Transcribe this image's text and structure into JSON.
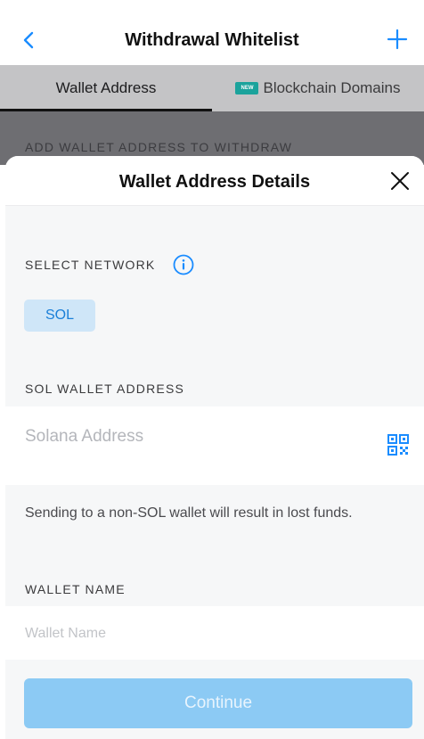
{
  "nav": {
    "title": "Withdrawal Whitelist"
  },
  "tabs": [
    {
      "label": "Wallet Address",
      "active": true
    },
    {
      "label": "Blockchain Domains",
      "badge": "NEW",
      "active": false
    }
  ],
  "background_caption": "ADD WALLET ADDRESS TO WITHDRAW",
  "sheet": {
    "title": "Wallet Address Details",
    "network": {
      "label": "SELECT NETWORK",
      "selected": "SOL"
    },
    "address": {
      "label": "SOL WALLET ADDRESS",
      "placeholder": "Solana Address"
    },
    "warning": "Sending to a non-SOL wallet will result in lost funds.",
    "wallet_name": {
      "label": "WALLET NAME",
      "placeholder": "Wallet Name"
    },
    "continue_label": "Continue"
  },
  "colors": {
    "accent": "#1a8cff",
    "chip_bg": "#cfe6f8",
    "button_disabled": "#8ccaf4",
    "badge_new": "#1ba39c"
  }
}
